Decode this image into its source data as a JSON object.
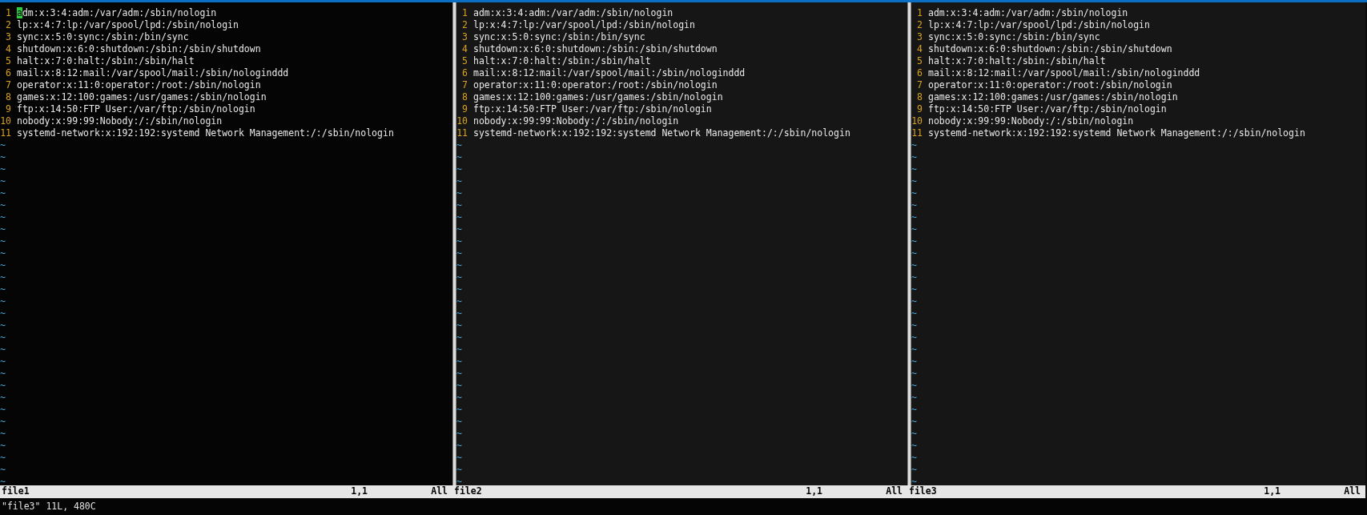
{
  "panes": [
    {
      "file": "file1",
      "cursor": "1,1",
      "position": "All",
      "has_cursor": true,
      "lines": [
        {
          "n": "1",
          "text": "adm:x:3:4:adm:/var/adm:/sbin/nologin"
        },
        {
          "n": "2",
          "text": "lp:x:4:7:lp:/var/spool/lpd:/sbin/nologin"
        },
        {
          "n": "3",
          "text": "sync:x:5:0:sync:/sbin:/bin/sync"
        },
        {
          "n": "4",
          "text": "shutdown:x:6:0:shutdown:/sbin:/sbin/shutdown"
        },
        {
          "n": "5",
          "text": "halt:x:7:0:halt:/sbin:/sbin/halt"
        },
        {
          "n": "6",
          "text": "mail:x:8:12:mail:/var/spool/mail:/sbin/nologinddd"
        },
        {
          "n": "7",
          "text": "operator:x:11:0:operator:/root:/sbin/nologin"
        },
        {
          "n": "8",
          "text": "games:x:12:100:games:/usr/games:/sbin/nologin"
        },
        {
          "n": "9",
          "text": "ftp:x:14:50:FTP User:/var/ftp:/sbin/nologin"
        },
        {
          "n": "10",
          "text": "nobody:x:99:99:Nobody:/:/sbin/nologin"
        },
        {
          "n": "11",
          "text": "systemd-network:x:192:192:systemd Network Management:/:/sbin/nologin"
        }
      ],
      "filler": [
        "~",
        "~",
        "~",
        "~",
        "~",
        "~",
        "~",
        "~",
        "~",
        "~",
        "~",
        "~",
        "~",
        "~",
        "~",
        "~",
        "~",
        "~",
        "~",
        "~",
        "~",
        "~",
        "~",
        "~",
        "~",
        "~",
        "~",
        "~",
        "~"
      ]
    },
    {
      "file": "file2",
      "cursor": "1,1",
      "position": "All",
      "has_cursor": false,
      "lines": [
        {
          "n": "1",
          "text": "adm:x:3:4:adm:/var/adm:/sbin/nologin"
        },
        {
          "n": "2",
          "text": "lp:x:4:7:lp:/var/spool/lpd:/sbin/nologin"
        },
        {
          "n": "3",
          "text": "sync:x:5:0:sync:/sbin:/bin/sync"
        },
        {
          "n": "4",
          "text": "shutdown:x:6:0:shutdown:/sbin:/sbin/shutdown"
        },
        {
          "n": "5",
          "text": "halt:x:7:0:halt:/sbin:/sbin/halt"
        },
        {
          "n": "6",
          "text": "mail:x:8:12:mail:/var/spool/mail:/sbin/nologinddd"
        },
        {
          "n": "7",
          "text": "operator:x:11:0:operator:/root:/sbin/nologin"
        },
        {
          "n": "8",
          "text": "games:x:12:100:games:/usr/games:/sbin/nologin"
        },
        {
          "n": "9",
          "text": "ftp:x:14:50:FTP User:/var/ftp:/sbin/nologin"
        },
        {
          "n": "10",
          "text": "nobody:x:99:99:Nobody:/:/sbin/nologin"
        },
        {
          "n": "11",
          "text": "systemd-network:x:192:192:systemd Network Management:/:/sbin/nologin"
        }
      ],
      "filler": [
        "~",
        "~",
        "~",
        "~",
        "~",
        "~",
        "~",
        "~",
        "~",
        "~",
        "~",
        "~",
        "~",
        "~",
        "~",
        "~",
        "~",
        "~",
        "~",
        "~",
        "~",
        "~",
        "~",
        "~",
        "~",
        "~",
        "~",
        "~",
        "~"
      ]
    },
    {
      "file": "file3",
      "cursor": "1,1",
      "position": "All",
      "has_cursor": false,
      "lines": [
        {
          "n": "1",
          "text": "adm:x:3:4:adm:/var/adm:/sbin/nologin"
        },
        {
          "n": "2",
          "text": "lp:x:4:7:lp:/var/spool/lpd:/sbin/nologin"
        },
        {
          "n": "3",
          "text": "sync:x:5:0:sync:/sbin:/bin/sync"
        },
        {
          "n": "4",
          "text": "shutdown:x:6:0:shutdown:/sbin:/sbin/shutdown"
        },
        {
          "n": "5",
          "text": "halt:x:7:0:halt:/sbin:/sbin/halt"
        },
        {
          "n": "6",
          "text": "mail:x:8:12:mail:/var/spool/mail:/sbin/nologinddd"
        },
        {
          "n": "7",
          "text": "operator:x:11:0:operator:/root:/sbin/nologin"
        },
        {
          "n": "8",
          "text": "games:x:12:100:games:/usr/games:/sbin/nologin"
        },
        {
          "n": "9",
          "text": "ftp:x:14:50:FTP User:/var/ftp:/sbin/nologin"
        },
        {
          "n": "10",
          "text": "nobody:x:99:99:Nobody:/:/sbin/nologin"
        },
        {
          "n": "11",
          "text": "systemd-network:x:192:192:systemd Network Management:/:/sbin/nologin"
        }
      ],
      "filler": [
        "~",
        "~",
        "~",
        "~",
        "~",
        "~",
        "~",
        "~",
        "~",
        "~",
        "~",
        "~",
        "~",
        "~",
        "~",
        "~",
        "~",
        "~",
        "~",
        "~",
        "~",
        "~",
        "~",
        "~",
        "~",
        "~",
        "~",
        "~",
        "~"
      ]
    }
  ],
  "command_line": "\"file3\" 11L, 480C"
}
